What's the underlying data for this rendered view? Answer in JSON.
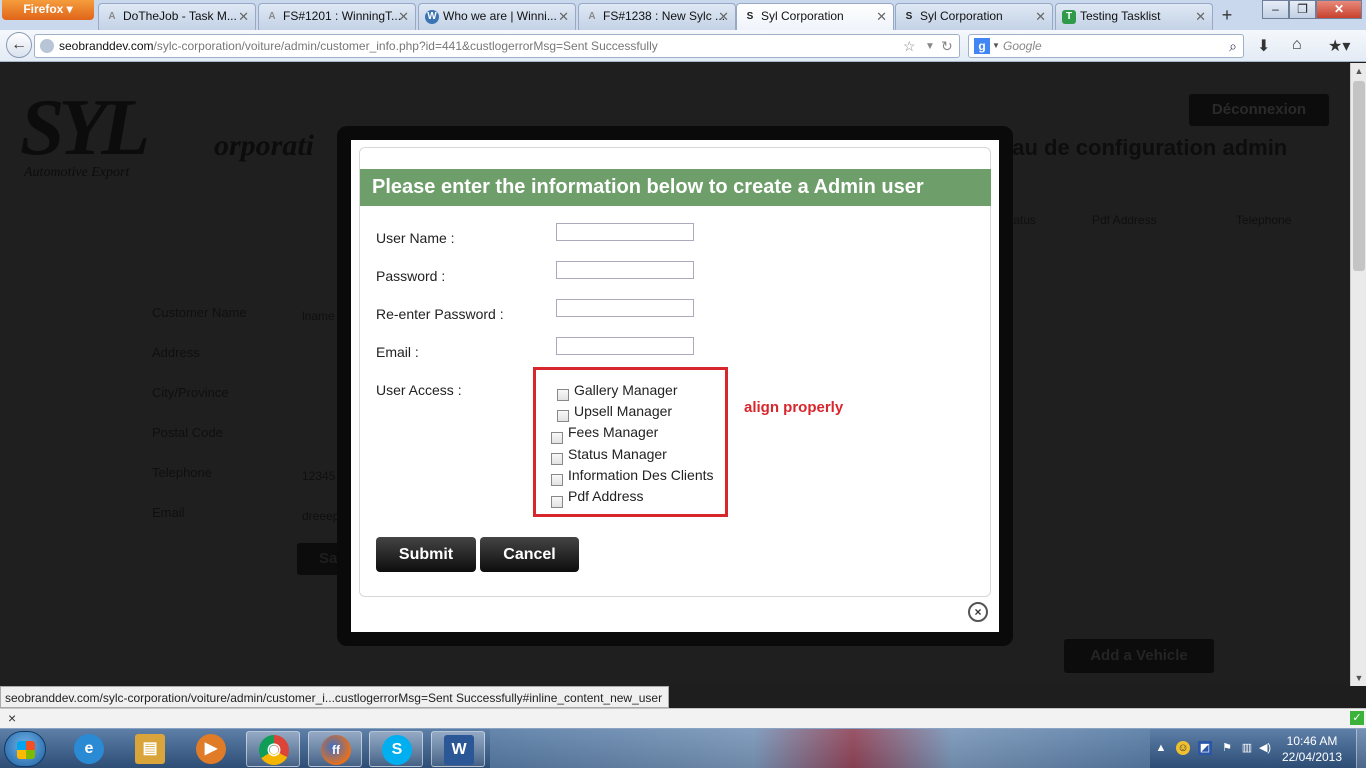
{
  "browser": {
    "menu_label": "Firefox",
    "tabs": [
      {
        "title": "DoTheJob - Task M...",
        "icon": "A",
        "icon_color": "#8c8c8c"
      },
      {
        "title": "FS#1201 : WinningT...",
        "icon": "A",
        "icon_color": "#8c8c8c"
      },
      {
        "title": "Who we are | Winni...",
        "icon": "W",
        "icon_color": "#3a74b5"
      },
      {
        "title": "FS#1238 : New Sylc ...",
        "icon": "A",
        "icon_color": "#8c8c8c"
      },
      {
        "title": "Syl Corporation",
        "icon": "S",
        "icon_color": "#222222"
      },
      {
        "title": "Syl Corporation",
        "icon": "S",
        "icon_color": "#222222"
      },
      {
        "title": "Testing Tasklist",
        "icon": "T",
        "icon_color": "#2f9a4a"
      }
    ],
    "new_tab": "+",
    "url_domain": "seobranddev.com",
    "url_path": "/sylc-corporation/voiture/admin/customer_info.php?id=441&custlogerrorMsg=Sent Successfully",
    "search_placeholder": "Google",
    "search_engine_icon": "g",
    "window_buttons": {
      "minimize": "–",
      "maximize": "❐",
      "close": "✕"
    }
  },
  "page": {
    "logo_text": "SYL",
    "logo_corp": "orporati",
    "logo_subtitle": "Automotive Export",
    "logout_label": "Déconnexion",
    "title": "eau de configuration admin",
    "columns": [
      "Status",
      "Pdf Address",
      "Telephone"
    ],
    "form_labels": [
      "Customer Name",
      "Address",
      "City/Province",
      "Postal Code",
      "Telephone",
      "Email"
    ],
    "form_values": [
      "lname",
      "12345",
      "dreeep"
    ],
    "save_label": "Save",
    "add_vehicle_label": "Add a Vehicle"
  },
  "modal": {
    "title": "Please enter the information below to create a Admin user",
    "fields": [
      {
        "label": "User Name :",
        "value": ""
      },
      {
        "label": "Password :",
        "value": ""
      },
      {
        "label": "Re-enter Password :",
        "value": ""
      },
      {
        "label": "Email :",
        "value": ""
      }
    ],
    "access_label": "User Access :",
    "access_options": [
      {
        "label": "Gallery Manager",
        "checked": false
      },
      {
        "label": "Upsell Manager",
        "checked": false
      },
      {
        "label": "Fees Manager",
        "checked": false
      },
      {
        "label": "Status Manager",
        "checked": false
      },
      {
        "label": "Information Des Clients",
        "checked": false
      },
      {
        "label": "Pdf Address",
        "checked": false
      }
    ],
    "annotation": "align properly",
    "annotation_color": "#d8262d",
    "header_color": "#6e9e6a",
    "submit_label": "Submit",
    "cancel_label": "Cancel",
    "close_glyph": "×"
  },
  "status_bar": {
    "link": "seobranddev.com/sylc-corporation/voiture/admin/customer_i...custlogerrorMsg=Sent Successfully#inline_content_new_user"
  },
  "addon_bar": {
    "close_glyph": "×"
  },
  "taskbar": {
    "apps": [
      {
        "name": "internet-explorer",
        "glyph": "e",
        "color": "#2a8ad4"
      },
      {
        "name": "file-explorer",
        "glyph": "▤",
        "color": "#d9a53a"
      },
      {
        "name": "media-player",
        "glyph": "▶",
        "color": "#e07b28"
      },
      {
        "name": "chrome",
        "glyph": "◉",
        "color": "#3c9b3c"
      },
      {
        "name": "firefox",
        "glyph": "ff",
        "color": "#e8701c"
      },
      {
        "name": "skype",
        "glyph": "S",
        "color": "#00aff0"
      },
      {
        "name": "word",
        "glyph": "W",
        "color": "#2b5797"
      }
    ],
    "clock_time": "10:46 AM",
    "clock_date": "22/04/2013"
  }
}
